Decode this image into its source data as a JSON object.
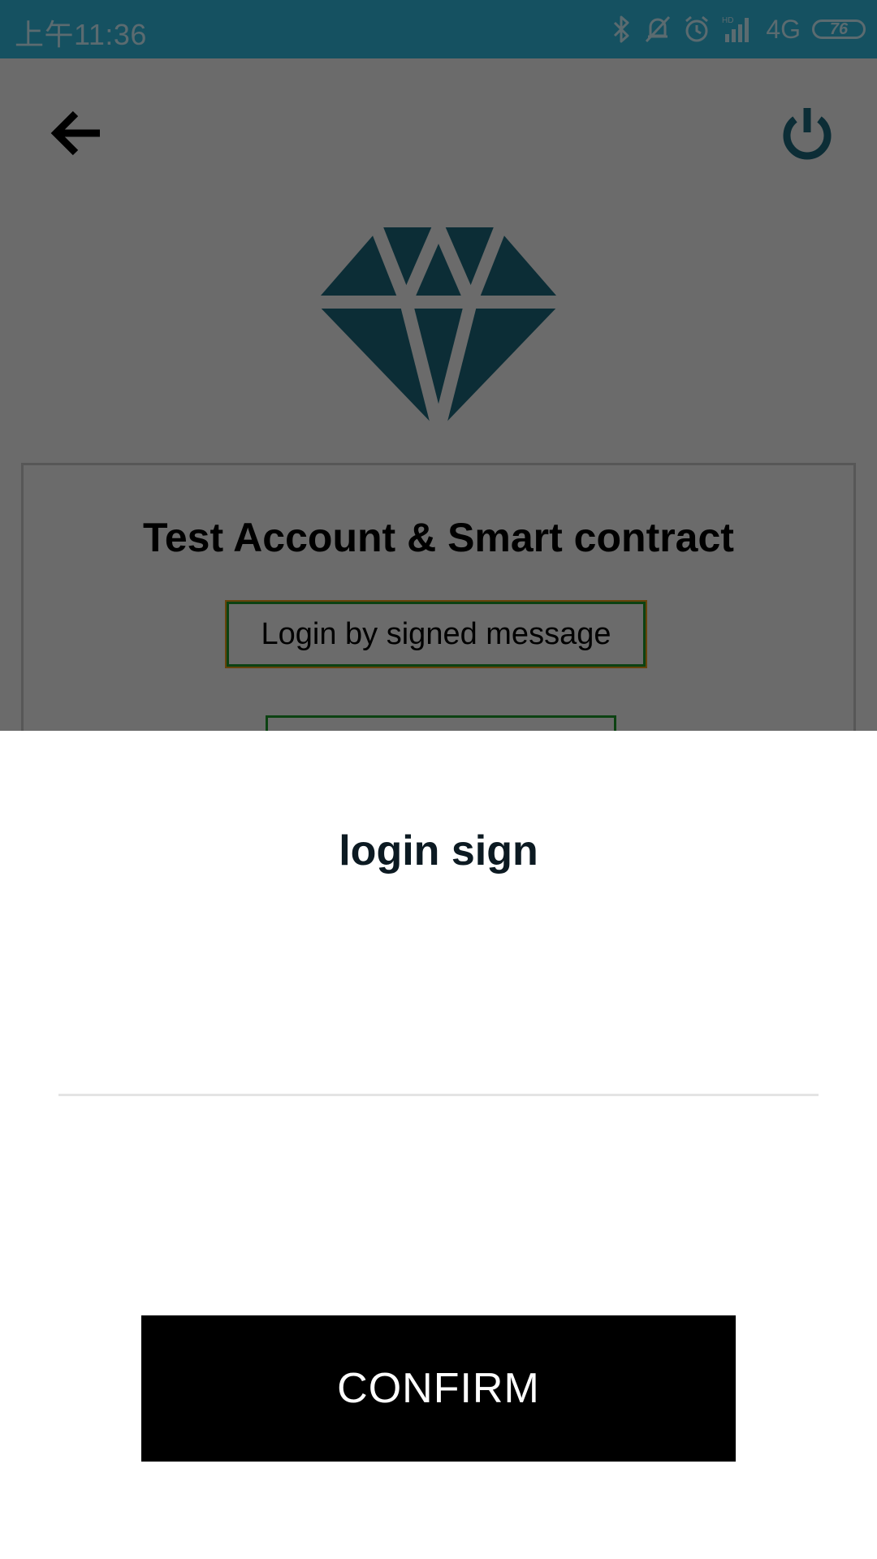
{
  "status_bar": {
    "time": "上午11:36",
    "network": "4G",
    "battery": "76",
    "icons": [
      "bluetooth-icon",
      "bell-muted-icon",
      "alarm-icon",
      "hd-signal-icon"
    ]
  },
  "header": {
    "back_icon": "arrow-left-icon",
    "power_icon": "power-icon",
    "accent_color": "#1d6d82"
  },
  "logo": {
    "icon": "diamond-icon"
  },
  "card": {
    "title": "Test Account & Smart contract",
    "signed_login_button": "Login by signed message"
  },
  "dialog": {
    "title": "login sign",
    "input_value": "",
    "confirm_label": "CONFIRM"
  }
}
